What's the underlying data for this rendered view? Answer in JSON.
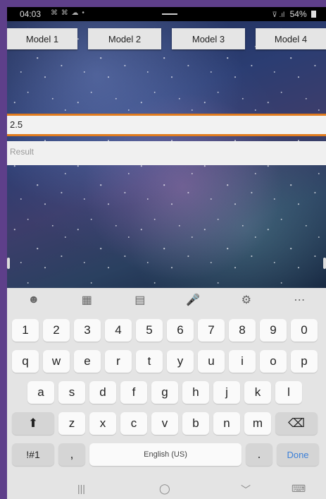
{
  "status_bar": {
    "time": "04:03",
    "notifications": "⌘ ⌘ ☁ •",
    "signal": "⊽ .ıl",
    "battery": "54%"
  },
  "tabs": [
    "Model 1",
    "Model 2",
    "Model 3",
    "Model 4"
  ],
  "input": {
    "value": "2.5"
  },
  "result": {
    "placeholder": "Result"
  },
  "keyboard": {
    "toolbar_icons": [
      "emoji-icon",
      "sticker-icon",
      "clipboard-icon",
      "mic-icon",
      "settings-icon",
      "more-icon"
    ],
    "toolbar_glyphs": [
      "☻",
      "▦",
      "▤",
      "🎤",
      "⚙",
      "⋯"
    ],
    "row_numbers": [
      "1",
      "2",
      "3",
      "4",
      "5",
      "6",
      "7",
      "8",
      "9",
      "0"
    ],
    "row_top": [
      "q",
      "w",
      "e",
      "r",
      "t",
      "y",
      "u",
      "i",
      "o",
      "p"
    ],
    "row_middle": [
      "a",
      "s",
      "d",
      "f",
      "g",
      "h",
      "j",
      "k",
      "l"
    ],
    "row_bottom": [
      "z",
      "x",
      "c",
      "v",
      "b",
      "n",
      "m"
    ],
    "shift_glyph": "⬆",
    "backspace_glyph": "⌫",
    "symbols_label": "!#1",
    "comma_label": ",",
    "space_label": "English (US)",
    "period_label": ".",
    "done_label": "Done"
  },
  "nav_bar": {
    "recent_glyph": "|||",
    "home_glyph": "◯",
    "back_glyph": "﹀",
    "keyboard_glyph": "⌨"
  },
  "colors": {
    "frame": "#5e3f8a",
    "accent_border": "#e07b1e",
    "done": "#3b7fd8"
  }
}
